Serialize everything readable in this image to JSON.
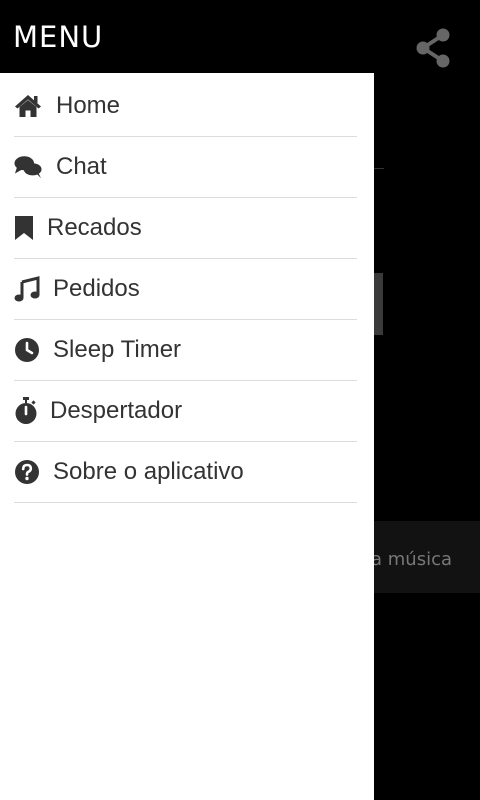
{
  "header": {
    "title": "MENU",
    "share_icon": "share-icon"
  },
  "background": {
    "partial_text": "a música"
  },
  "drawer": {
    "items": [
      {
        "label": "Home",
        "icon": "home-icon"
      },
      {
        "label": "Chat",
        "icon": "chat-icon"
      },
      {
        "label": "Recados",
        "icon": "bookmark-icon"
      },
      {
        "label": "Pedidos",
        "icon": "music-note-icon"
      },
      {
        "label": "Sleep Timer",
        "icon": "clock-icon"
      },
      {
        "label": "Despertador",
        "icon": "stopwatch-icon"
      },
      {
        "label": "Sobre o aplicativo",
        "icon": "question-circle-icon"
      }
    ]
  },
  "colors": {
    "drawer_bg": "#ffffff",
    "app_bg": "#000000",
    "text": "#333333",
    "divider": "#dddddd"
  }
}
